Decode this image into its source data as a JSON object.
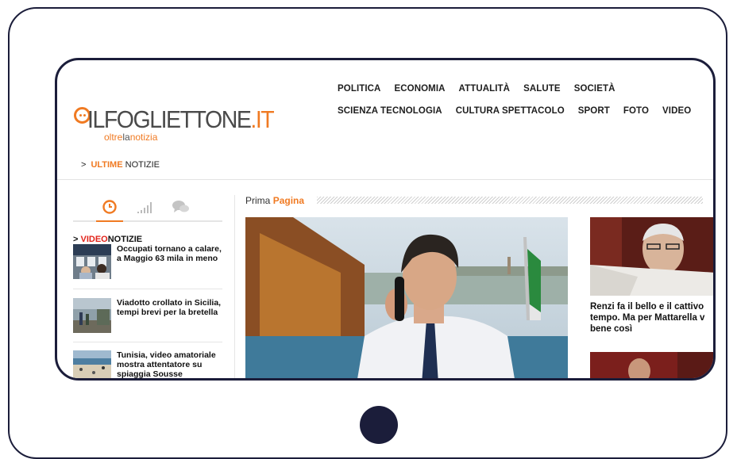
{
  "header": {
    "logo": {
      "name": "ILFOGLIETTONE",
      "tld": ".IT",
      "tagline_start": "oltre",
      "tagline_mid": "la",
      "tagline_end": "notizia"
    },
    "nav_row1": [
      "POLITICA",
      "ECONOMIA",
      "ATTUALITÀ",
      "SALUTE",
      "SOCIETÀ"
    ],
    "nav_row2": [
      "SCIENZA TECNOLOGIA",
      "CULTURA SPETTACOLO",
      "SPORT",
      "FOTO",
      "VIDEO"
    ],
    "ultime": {
      "chevron": ">",
      "highlight": "ULTIME",
      "rest": "NOTIZIE"
    }
  },
  "sidebar": {
    "tabs": [
      {
        "icon": "clock-icon",
        "active": true
      },
      {
        "icon": "signal-bars-icon",
        "active": false
      },
      {
        "icon": "chat-bubbles-icon",
        "active": false
      }
    ],
    "video_head": {
      "chevron": ">",
      "highlight": "VIDEO",
      "rest": "NOTIZIE"
    },
    "items": [
      {
        "title": "Occupati tornano a calare, a Maggio 63 mila in meno"
      },
      {
        "title": "Viadotto crollato in Sicilia, tempi brevi per la bretella"
      },
      {
        "title": "Tunisia, video amatoriale mostra attentatore su spiaggia Sousse"
      }
    ]
  },
  "main": {
    "section_label": {
      "start": "Prima",
      "highlight": "Pagina"
    },
    "side_story": {
      "line1": "Renzi fa il bello e il cattivo",
      "line2": "tempo. Ma per Mattarella v",
      "line3": "bene così"
    }
  },
  "colors": {
    "accent": "#f07a22",
    "frame": "#1b1d3a",
    "video_red": "#e2231a"
  }
}
